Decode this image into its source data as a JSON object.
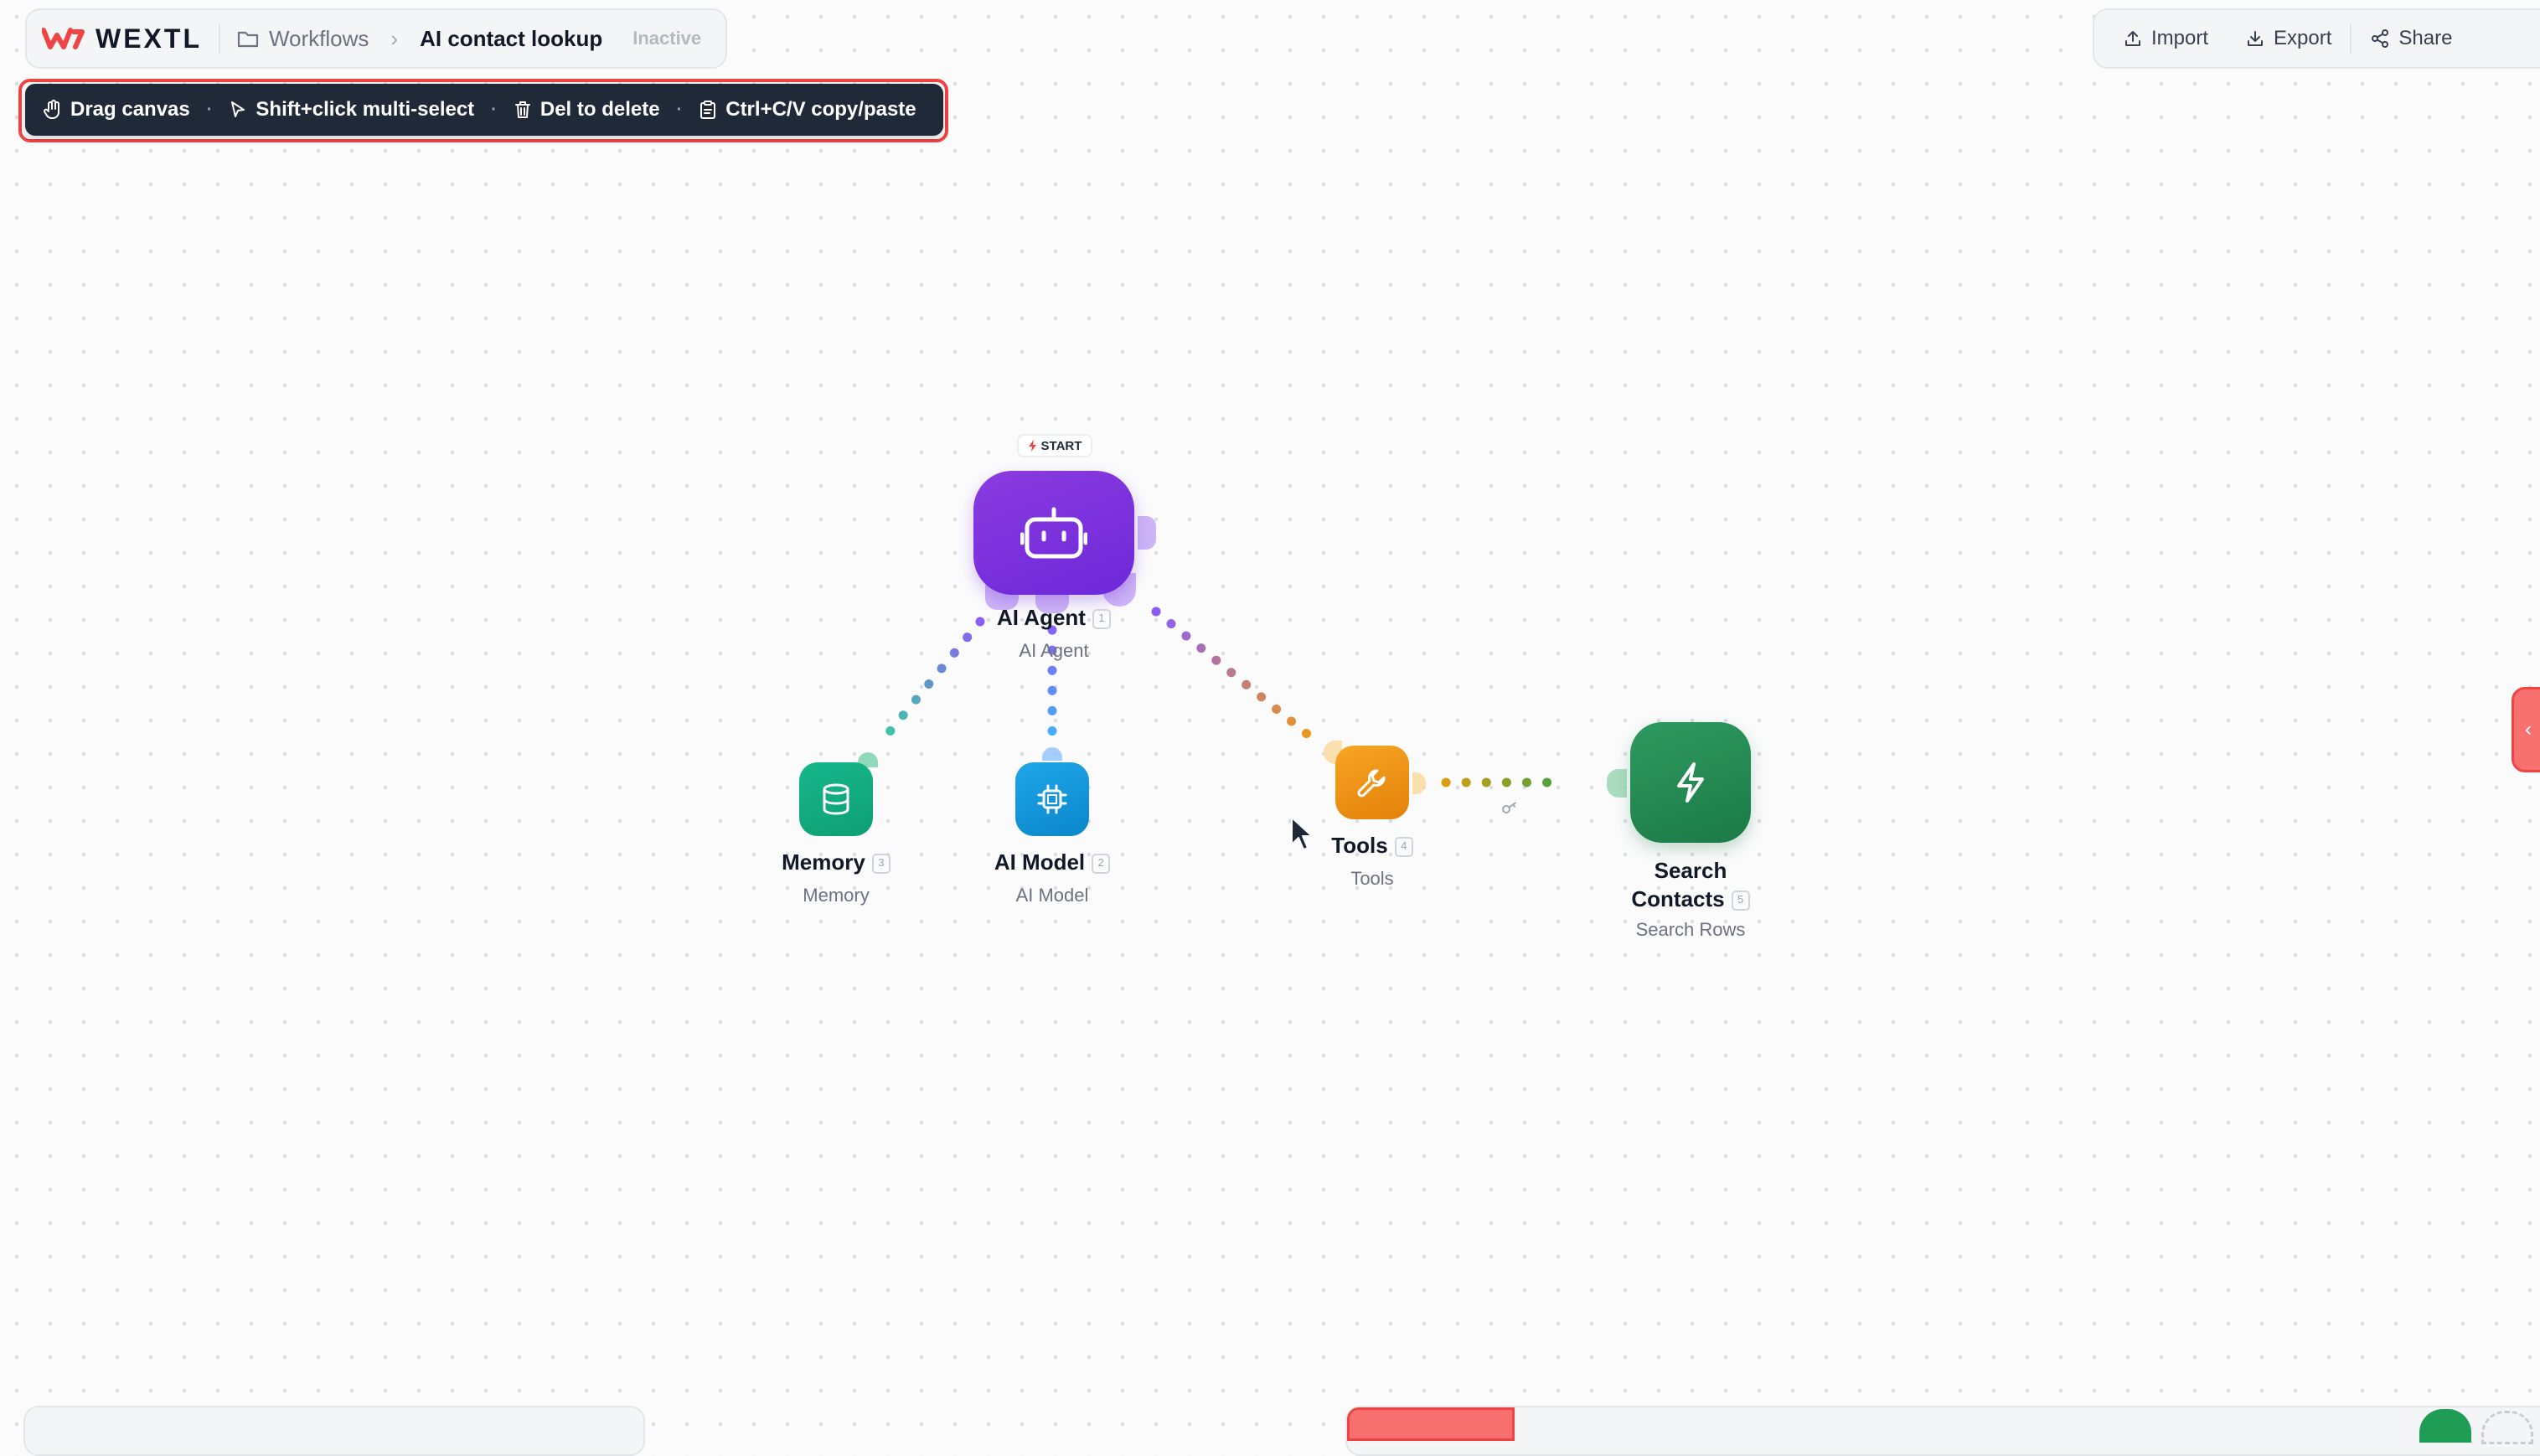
{
  "header": {
    "brand": "WEXTL",
    "breadcrumb": {
      "root": "Workflows",
      "current": "AI contact lookup"
    },
    "status": "Inactive"
  },
  "actions": {
    "import": "Import",
    "export": "Export",
    "share": "Share"
  },
  "hints": [
    {
      "label": "Drag canvas",
      "icon": "hand-icon"
    },
    {
      "label": "Shift+click multi-select",
      "icon": "pointer-icon"
    },
    {
      "label": "Del to delete",
      "icon": "trash-icon"
    },
    {
      "label": "Ctrl+C/V copy/paste",
      "icon": "clipboard-icon"
    }
  ],
  "start_chip": "START",
  "nodes": {
    "agent": {
      "label": "AI Agent",
      "sublabel": "AI Agent",
      "index": "1",
      "color": "#7c3aed",
      "icon": "robot-icon"
    },
    "memory": {
      "label": "Memory",
      "sublabel": "Memory",
      "index": "3",
      "color": "#10a37f",
      "icon": "database-icon"
    },
    "model": {
      "label": "AI Model",
      "sublabel": "AI Model",
      "index": "2",
      "color": "#0ea5e9",
      "icon": "chip-icon"
    },
    "tools": {
      "label": "Tools",
      "sublabel": "Tools",
      "index": "4",
      "color": "#f59e0b",
      "icon": "wrench-icon"
    },
    "search": {
      "label": "Search Contacts",
      "sublabel": "Search Rows",
      "index": "5",
      "color": "#1f8a52",
      "icon": "lightning-icon"
    }
  }
}
